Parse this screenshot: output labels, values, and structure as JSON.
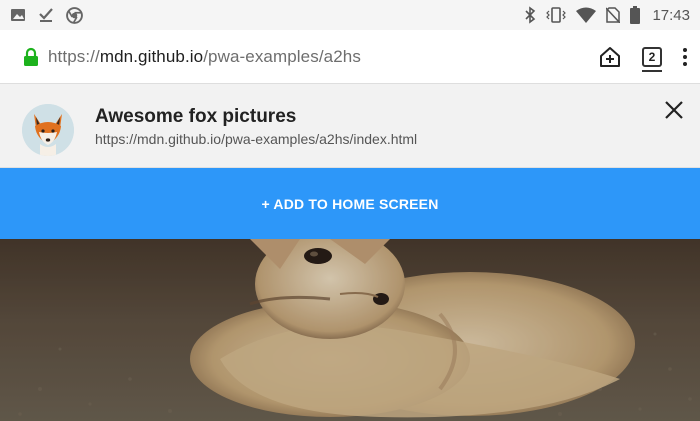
{
  "status_bar": {
    "time": "17:43",
    "left_icons": [
      "image-icon",
      "download-done-icon",
      "chrome-icon"
    ],
    "right_icons": [
      "bluetooth-icon",
      "vibrate-icon",
      "wifi-icon",
      "no-sim-icon",
      "battery-icon"
    ]
  },
  "url_bar": {
    "scheme": "https://",
    "host": "mdn.github.io",
    "path": "/pwa-examples/a2hs",
    "tab_count": "2",
    "add_to_home_icon": "home-plus-icon",
    "menu_icon": "more-vert-icon"
  },
  "install_prompt": {
    "app_name": "Awesome fox pictures",
    "app_url": "https://mdn.github.io/pwa-examples/a2hs/index.html",
    "close_icon": "close-icon"
  },
  "add_button": {
    "label": "+ ADD TO HOME SCREEN"
  },
  "colors": {
    "accent": "#2d97f9",
    "lock_green": "#1db21d",
    "card_bg": "#f2f2f2"
  }
}
